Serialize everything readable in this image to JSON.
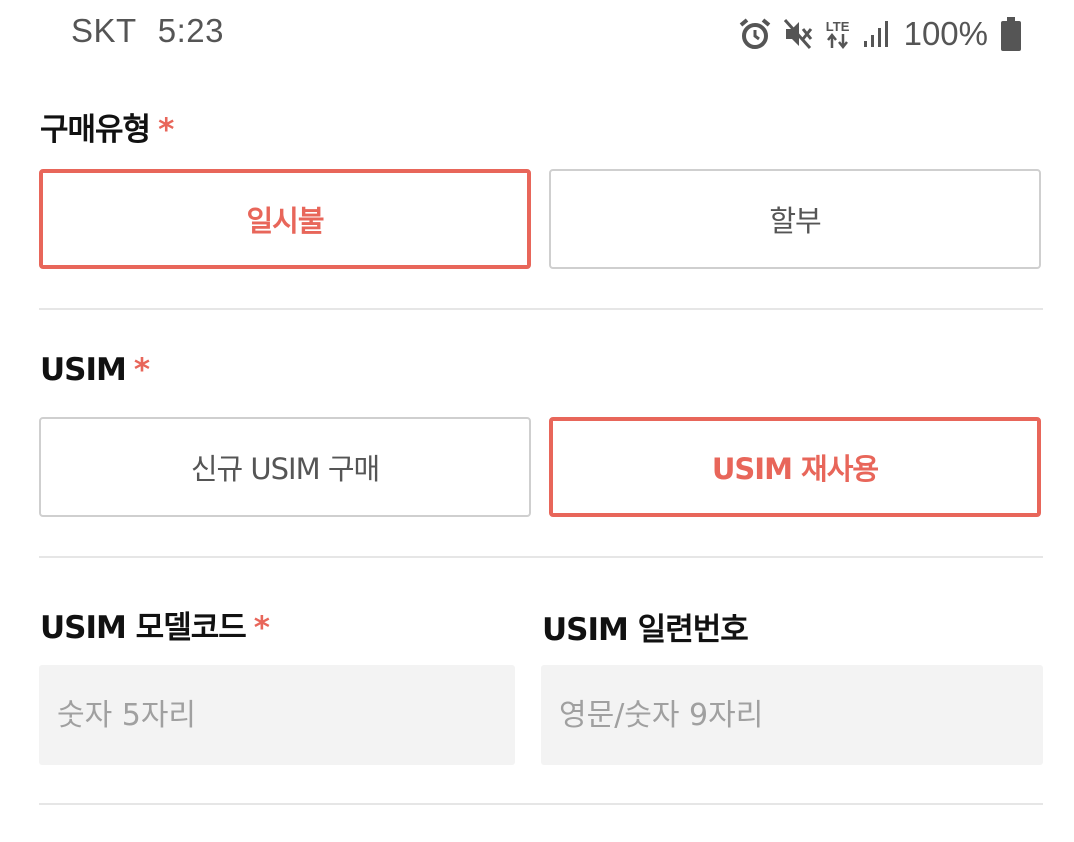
{
  "status_bar": {
    "carrier": "SKT",
    "time": "5:23",
    "network": "LTE",
    "battery": "100%",
    "icons": [
      "alarm-icon",
      "mute-icon",
      "lte-icon",
      "signal-icon",
      "battery-icon"
    ]
  },
  "purchase_type": {
    "label": "구매유형",
    "required": "*",
    "options": [
      {
        "label": "일시불",
        "selected": true
      },
      {
        "label": "할부",
        "selected": false
      }
    ]
  },
  "usim": {
    "label": "USIM",
    "required": "*",
    "options": [
      {
        "label": "신규 USIM 구매",
        "selected": false
      },
      {
        "label": "USIM 재사용",
        "selected": true
      }
    ]
  },
  "usim_model_code": {
    "label": "USIM 모델코드",
    "required": "*",
    "placeholder": "숫자 5자리"
  },
  "usim_serial": {
    "label": "USIM 일련번호",
    "placeholder": "영문/숫자 9자리"
  },
  "colors": {
    "accent": "#e8665a",
    "border": "#cfcfcf",
    "input_bg": "#f3f3f3",
    "divider": "#e6e6e6"
  }
}
